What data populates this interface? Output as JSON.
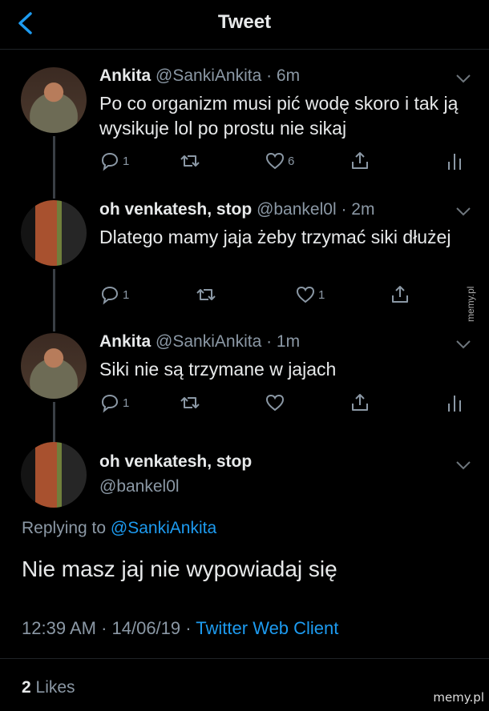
{
  "header": {
    "title": "Tweet"
  },
  "tweets": [
    {
      "name": "Ankita",
      "handle": "@SankiAnkita · 6m",
      "text": "Po co organizm musi pić wodę skoro i tak ją wysikuje lol po prostu nie sikaj",
      "reply_count": "1",
      "retweet_count": "",
      "like_count": "6"
    },
    {
      "name": "oh venkatesh, stop",
      "handle": "@bankel0l · 2m",
      "text": "Dlatego mamy jaja żeby trzymać siki dłużej",
      "reply_count": "1",
      "retweet_count": "",
      "like_count": "1"
    },
    {
      "name": "Ankita",
      "handle": "@SankiAnkita · 1m",
      "text": "Siki nie są trzymane w jajach",
      "reply_count": "1",
      "retweet_count": "",
      "like_count": ""
    }
  ],
  "main": {
    "name": "oh venkatesh, stop",
    "handle": "@bankel0l",
    "replying_prefix": "Replying to ",
    "replying_to": "@SankiAnkita",
    "text": "Nie masz jaj nie wypowiadaj się",
    "time_date": "12:39 AM · 14/06/19 · ",
    "client": "Twitter Web Client",
    "likes_count": "2",
    "likes_label": " Likes"
  },
  "watermark": "memy.pl",
  "icons": {
    "back": "chevron-left-icon",
    "more": "chevron-down-icon",
    "reply": "reply-icon",
    "retweet": "retweet-icon",
    "like": "heart-icon",
    "share": "share-icon",
    "analytics": "analytics-icon"
  },
  "colors": {
    "background": "#000000",
    "accent": "#1d9bf0",
    "secondary_text": "#8b98a5"
  }
}
